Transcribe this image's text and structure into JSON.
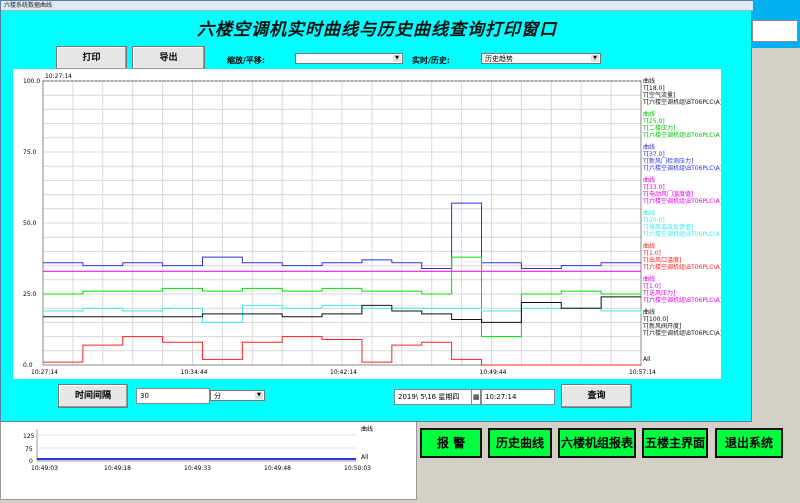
{
  "window": {
    "title": "六楼系统数据曲线"
  },
  "heading": "六楼空调机实时曲线与历史曲线查询打印窗口",
  "toolbar": {
    "print_label": "打印",
    "export_label": "导出",
    "zoom_label": "缩放/平移:",
    "zoom_value": "",
    "mode_label": "实时/历史:",
    "mode_value": "历史趋势"
  },
  "chart_data": {
    "type": "line",
    "cursor_time": "10:27:14",
    "ylim": [
      0,
      100
    ],
    "y_ticks": [
      "100.0",
      "75.0",
      "50.0",
      "25.0",
      "0.0"
    ],
    "x_ticks": [
      "10:27:14",
      "10:34:44",
      "10:42:14",
      "10:49:44",
      "10:57:14"
    ],
    "x": [
      0,
      8,
      16,
      24,
      32,
      40,
      48,
      56,
      64,
      70,
      76,
      82,
      88,
      96,
      104,
      112,
      120
    ],
    "series": [
      {
        "color": "#3030e0",
        "values": [
          36,
          35,
          36,
          35,
          38,
          36,
          35,
          36,
          37,
          36,
          34,
          57,
          36,
          34,
          35,
          36,
          36
        ]
      },
      {
        "color": "#e000e0",
        "values": [
          33,
          33,
          33,
          33,
          33,
          33,
          33,
          33,
          33,
          33,
          33,
          33,
          33,
          33,
          33,
          33,
          33
        ]
      },
      {
        "color": "#00e000",
        "values": [
          25,
          26,
          26,
          27,
          26,
          27,
          26,
          27,
          26,
          26,
          25,
          38,
          10,
          25,
          26,
          25,
          26
        ]
      },
      {
        "color": "#40e8e8",
        "values": [
          19,
          20,
          19,
          20,
          15,
          21,
          20,
          21,
          20,
          20,
          20,
          20,
          19,
          20,
          20,
          19,
          18
        ]
      },
      {
        "color": "#111111",
        "values": [
          17,
          17,
          17,
          17,
          18,
          18,
          17,
          18,
          21,
          19,
          18,
          16,
          15,
          22,
          20,
          24,
          24
        ]
      },
      {
        "color": "#ff2020",
        "values": [
          1,
          7,
          10,
          8,
          2,
          8,
          10,
          9,
          1,
          7,
          8,
          2,
          0,
          0,
          0,
          0,
          0
        ]
      }
    ],
    "legend": [
      {
        "color": "#111111",
        "lines": [
          "曲线",
          "T[18.0]",
          "T[空气流量]",
          "T[六楼空调机组\\BT06PLC\\A]"
        ]
      },
      {
        "color": "#00c000",
        "lines": [
          "曲线",
          "T[25.0]",
          "T[二楼压力]",
          "T[六楼空调机组\\BT06PLC\\A]"
        ]
      },
      {
        "color": "#3030e0",
        "lines": [
          "曲线",
          "T[37.0]",
          "T[新风门检测压力]",
          "T[六楼空调机组\\BT06PLC\\A]"
        ]
      },
      {
        "color": "#e000e0",
        "lines": [
          "曲线",
          "T[33.0]",
          "T[电动风门温度值]",
          "T[六楼空调机组\\BT06PLC\\A]"
        ]
      },
      {
        "color": "#40e8e8",
        "lines": [
          "曲线",
          "T[20.0]",
          "T[排风温度反馈值]",
          "T[六楼空调机组\\BT06PLC\\A]"
        ]
      },
      {
        "color": "#ff2020",
        "lines": [
          "曲线",
          "T[1.0]",
          "T[出风口温度]",
          "T[六楼空调机组\\BT06PLC\\A]"
        ]
      },
      {
        "color": "#e000e0",
        "lines": [
          "曲线",
          "T[1.0]",
          "T[送风压力]",
          "T[六楼空调机组\\BT06PLC\\A]"
        ]
      },
      {
        "color": "#111111",
        "lines": [
          "曲线",
          "T[100.0]",
          "T[新风阀开度]",
          "T[六楼空调机组\\BT06PLC\\A]"
        ]
      }
    ],
    "legend_last": "All"
  },
  "controls": {
    "interval_button": "时间间隔",
    "interval_value": "30",
    "unit_value": "分",
    "date_value": "2019\\ 5\\16 星期四",
    "time_value": "10:27:14",
    "query_button": "查询"
  },
  "mini_chart": {
    "y_ticks": [
      "125",
      "75",
      "0"
    ],
    "x_ticks": [
      "10:49:03",
      "10:49:18",
      "10:49:33",
      "10:49:48",
      "10:50:03"
    ],
    "legend": "曲线",
    "legend_all": "All"
  },
  "nav": {
    "alarm": "报  警",
    "history": "历史曲线",
    "report": "六楼机组报表",
    "fifth_floor": "五楼主界面",
    "exit": "退出系统"
  }
}
